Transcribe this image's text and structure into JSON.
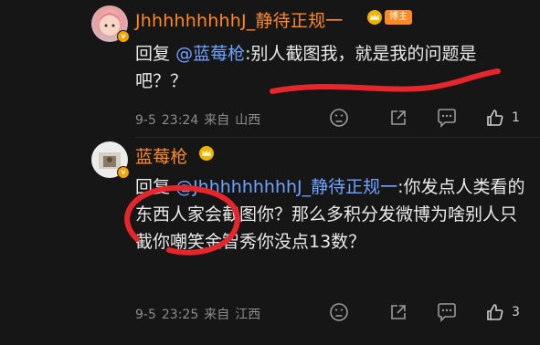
{
  "comments": [
    {
      "username": "JhhhhhhhhhJ_静待正规一",
      "role_badge": "博主",
      "reply_prefix": "回复",
      "mention": "@蓝莓枪",
      "body": ":别人截图我，就是我的问题是吧？？",
      "date": "9-5",
      "time": "23:24",
      "source_prefix": "来自",
      "location": "山西",
      "likes": "1"
    },
    {
      "username": "蓝莓枪",
      "reply_prefix": "回复",
      "mention": "@JhhhhhhhhhJ_静待正规一",
      "body": ":你发点人类看的东西人家会截图你？那么多积分发微博为啥别人只截你嘲笑金智秀你没点13数？",
      "date": "9-5",
      "time": "23:25",
      "source_prefix": "来自",
      "location": "江西",
      "likes": "3"
    }
  ],
  "colors": {
    "background": "#161616",
    "username": "#ff8a1f",
    "mention": "#6fa3ff",
    "text": "#eaeaea",
    "meta": "#8c8c8c",
    "scribble": "#e5262d"
  },
  "icons": {
    "verified": "verified-badge-icon",
    "crown": "crown-icon",
    "dislike": "dislike-face-icon",
    "share": "share-icon",
    "comment": "comment-icon",
    "like": "thumbs-up-icon"
  }
}
